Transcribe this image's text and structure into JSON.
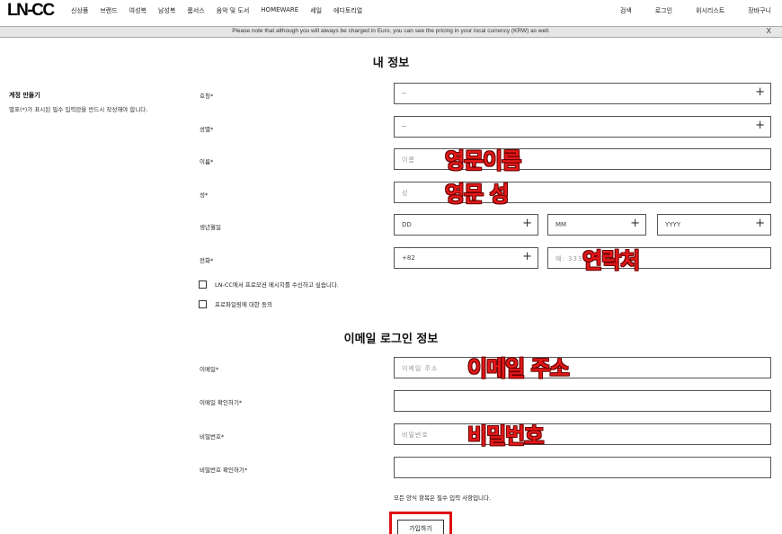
{
  "nav": {
    "logo": "LN-CC",
    "left_items": [
      "신상품",
      "브랜드",
      "여성복",
      "남성복",
      "룸서스",
      "음악 및 도서",
      "HOMEWARE",
      "세일",
      "에디토리얼"
    ],
    "right_items": [
      "검색",
      "로그인",
      "위시리스트",
      "장바구니"
    ]
  },
  "notice": {
    "text": "Please note that although you will always be charged in Euro, you can see the pricing in your local currency (KRW) as well.",
    "close": "X"
  },
  "profile": {
    "title": "내 정보",
    "side_title": "계정 만들기",
    "side_desc": "별표(*)가 표시된 필수 입력란을 반드시 작성해야 합니다.",
    "title_label": "호칭*",
    "title_value": "--",
    "gender_label": "성별*",
    "gender_value": "--",
    "firstname_label": "이름*",
    "firstname_placeholder": "이름",
    "lastname_label": "성*",
    "lastname_placeholder": "성",
    "dob_label": "생년월일",
    "dob_day": "DD",
    "dob_month": "MM",
    "dob_year": "YYYY",
    "phone_label": "전화*",
    "phone_code": "+82",
    "phone_placeholder": "예: 333",
    "promo_checkbox": "LN-CC에서 프로모션 메시지를 수신하고 싶습니다.",
    "profiling_checkbox": "프로파일링에 대한 동의"
  },
  "login": {
    "title": "이메일 로그인 정보",
    "email_label": "이메일*",
    "email_placeholder": "이메일 주소",
    "email_confirm_label": "이메일 확인하기*",
    "password_label": "비밀번호*",
    "password_placeholder": "비밀번호",
    "password_confirm_label": "비밀번호 확인하기*",
    "required_note": "모든 양식 항목은 필수 입력 사항입니다.",
    "submit": "가입하기"
  },
  "annotations": {
    "english_first": "영문이름",
    "english_last": "영문 성",
    "contact": "연락처",
    "email": "이메일 주소",
    "password": "비밀번호"
  },
  "colors": {
    "annotation_red": "#e31818",
    "notice_bg": "#e6e6e6"
  }
}
